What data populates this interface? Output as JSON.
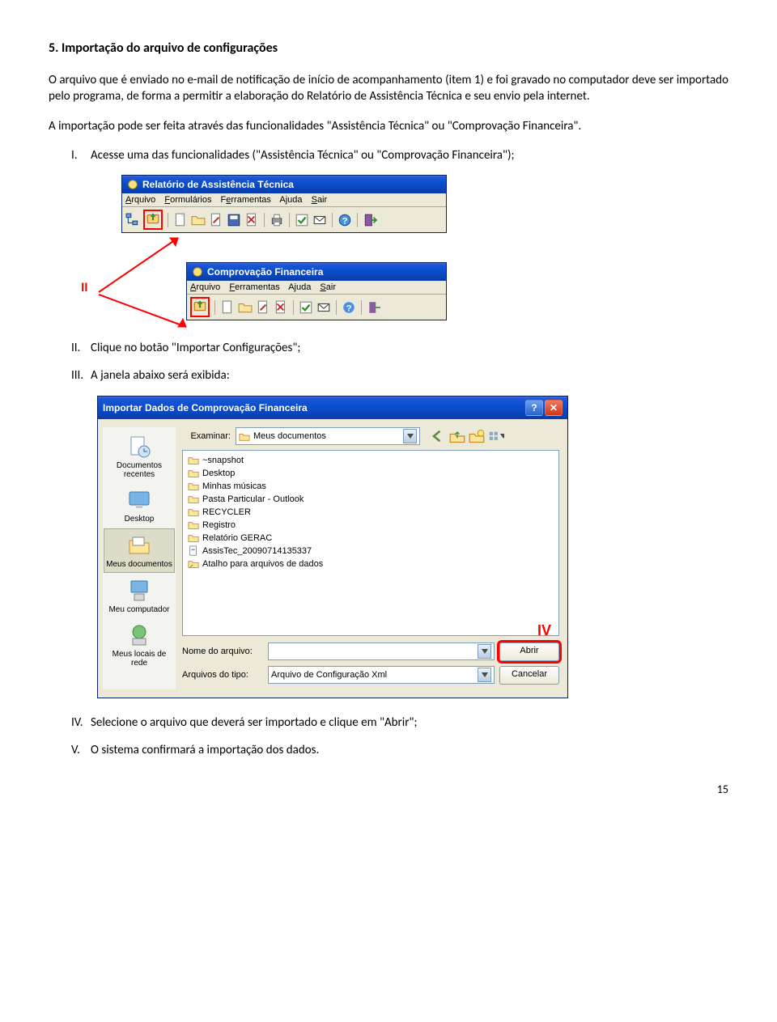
{
  "section": {
    "title": "5. Importação do arquivo de configurações",
    "p1": "O arquivo que é enviado no e-mail de notificação de início de acompanhamento (item 1) e foi gravado no computador deve ser importado pelo programa, de forma a permitir a elaboração do Relatório de Assistência Técnica e seu envio pela internet.",
    "p2": "A importação pode ser feita através das funcionalidades \"Assistência Técnica\" ou \"Comprovação Financeira\".",
    "step_I_num": "I.",
    "step_I": "Acesse uma das funcionalidades (\"Assistência Técnica\" ou \"Comprovação Financeira\");",
    "step_II_num": "II.",
    "step_II": "Clique no botão \"Importar Configurações\";",
    "step_III_num": "III.",
    "step_III": "A janela abaixo será exibida:",
    "step_IV_num": "IV.",
    "step_IV": "Selecione o arquivo que deverá ser importado e clique em \"Abrir\";",
    "step_V_num": "V.",
    "step_V": "O sistema confirmará a importação dos dados."
  },
  "annotation": {
    "label_II": "II",
    "label_IV": "IV"
  },
  "win1": {
    "title": "Relatório de Assistência Técnica",
    "menu": {
      "arquivo": "Arquivo",
      "formularios": "Formulários",
      "ferramentas": "Ferramentas",
      "ajuda": "Ajuda",
      "sair": "Sair"
    }
  },
  "win2": {
    "title": "Comprovação Financeira",
    "menu": {
      "arquivo": "Arquivo",
      "ferramentas": "Ferramentas",
      "ajuda": "Ajuda",
      "sair": "Sair"
    }
  },
  "dialog": {
    "title": "Importar Dados de Comprovação Financeira",
    "examinar_label": "Examinar:",
    "examinar_value": "Meus documentos",
    "places": {
      "recentes": "Documentos recentes",
      "desktop": "Desktop",
      "meusdocs": "Meus documentos",
      "meucomp": "Meu computador",
      "rede": "Meus locais de rede"
    },
    "files": [
      "~snapshot",
      "Desktop",
      "Minhas músicas",
      "Pasta Particular - Outlook",
      "RECYCLER",
      "Registro",
      "Relatório GERAC",
      "AssisTec_20090714135337",
      "Atalho para arquivos de dados"
    ],
    "nome_label": "Nome do arquivo:",
    "nome_value": "",
    "tipo_label": "Arquivos do tipo:",
    "tipo_value": "Arquivo de Configuração Xml",
    "abrir": "Abrir",
    "cancelar": "Cancelar"
  },
  "page_number": "15"
}
